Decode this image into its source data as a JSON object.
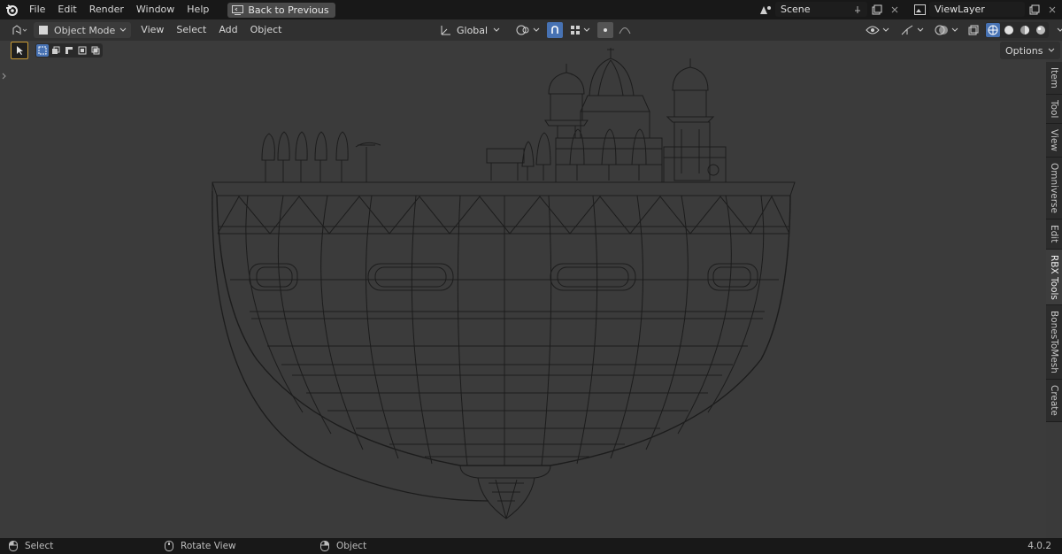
{
  "topbar": {
    "menus": [
      "File",
      "Edit",
      "Render",
      "Window",
      "Help"
    ],
    "back_label": "Back to Previous",
    "scene_name": "Scene",
    "view_layer": "ViewLayer"
  },
  "header": {
    "mode": "Object Mode",
    "menus": [
      "View",
      "Select",
      "Add",
      "Object"
    ],
    "orientation": "Global"
  },
  "viewport": {
    "options_label": "Options"
  },
  "sidebar_tabs": [
    "Item",
    "Tool",
    "View",
    "Omniverse",
    "Edit",
    "RBX Tools",
    "BonesToMesh",
    "Create"
  ],
  "statusbar": {
    "select": "Select",
    "rotate": "Rotate View",
    "object": "Object",
    "version": "4.0.2"
  },
  "colors": {
    "accent": "#4772b3",
    "wire": "#1e1e1e",
    "viewport_bg": "#3b3b3b"
  }
}
